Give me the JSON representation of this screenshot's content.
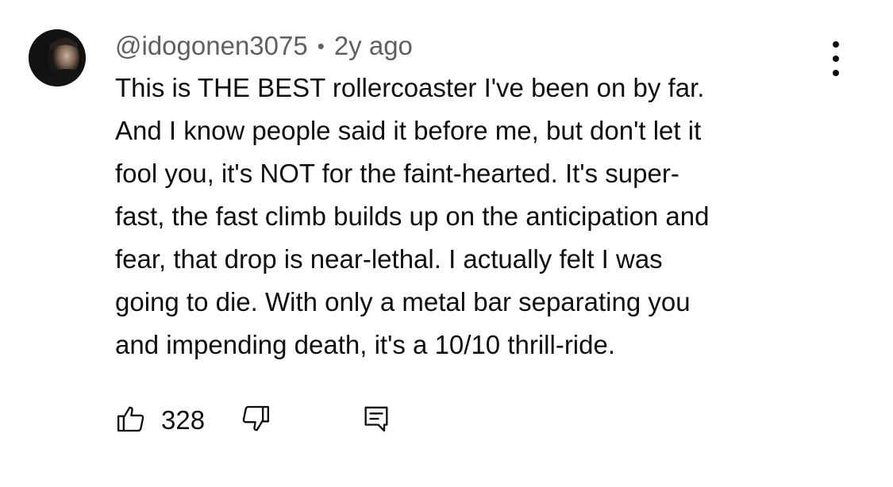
{
  "comment": {
    "username": "@idogonen3075",
    "separator": "•",
    "timestamp": "2y ago",
    "text_lines": [
      "This is THE BEST rollercoaster I've been on by far.",
      "And I know people said it before me, but don't let it",
      "fool you, it's NOT for the faint-hearted. It's super-",
      "fast, the fast climb builds up on the anticipation and",
      "fear, that drop is near-lethal. I actually felt I was",
      "going to die. With only a metal bar separating you",
      "and impending death, it's a 10/10 thrill-ride."
    ],
    "like_count": "328"
  },
  "icons": {
    "like": "thumbs-up-icon",
    "dislike": "thumbs-down-icon",
    "reply": "comment-reply-icon",
    "menu": "more-vertical-icon"
  },
  "colors": {
    "text": "#0f0f0f",
    "meta": "#606060",
    "background": "#ffffff"
  }
}
